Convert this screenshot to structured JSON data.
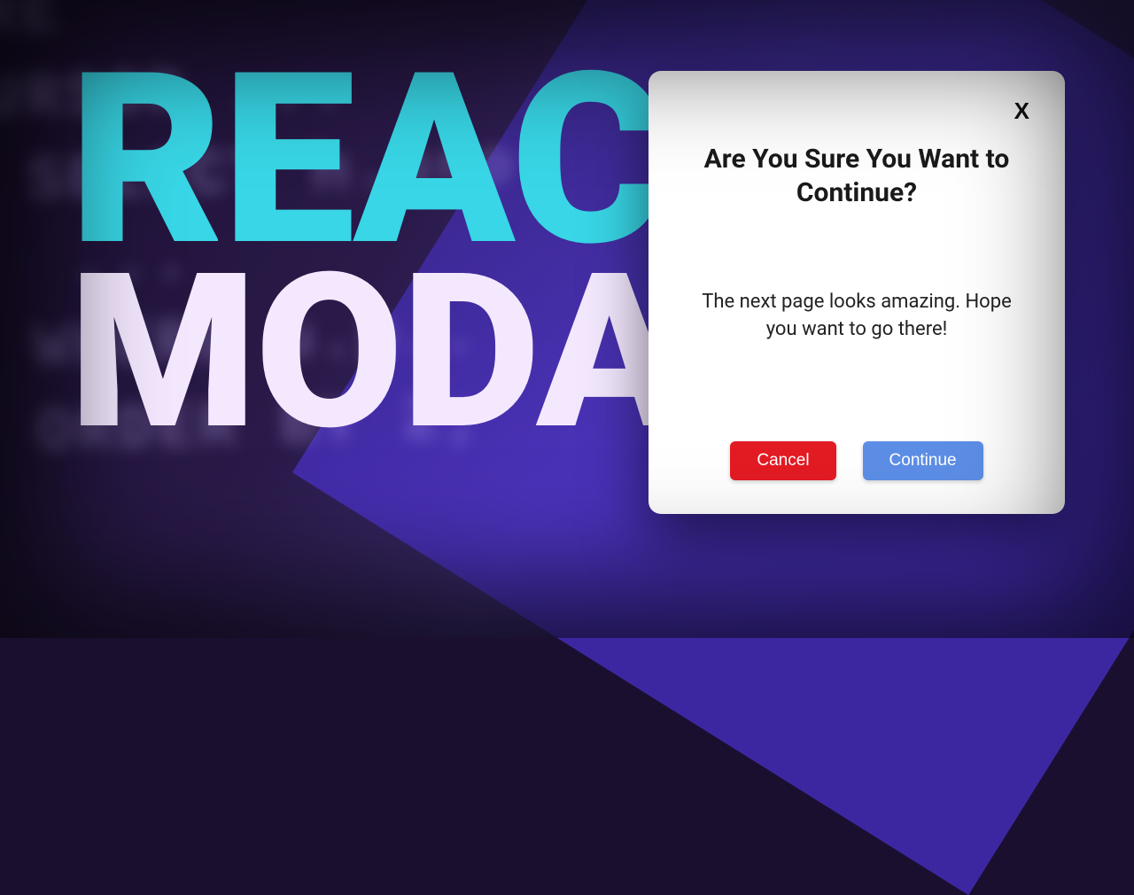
{
  "background": {
    "code_lines": "ARE\nCURSOR ...\n  SELECT h.pro\n   ...\n  WHERE u.p..\n  ORDER BY 2;"
  },
  "title": {
    "top": "REACT",
    "bottom": "MODAL"
  },
  "modal": {
    "close_label": "X",
    "heading": "Are You Sure You Want to Continue?",
    "body": "The next page looks amazing. Hope you want to go there!",
    "cancel_label": "Cancel",
    "continue_label": "Continue"
  },
  "colors": {
    "accent_cyan": "#38d6e6",
    "modal_bg": "#ffffff",
    "cancel": "#e31b23",
    "continue": "#5d8ee6"
  }
}
